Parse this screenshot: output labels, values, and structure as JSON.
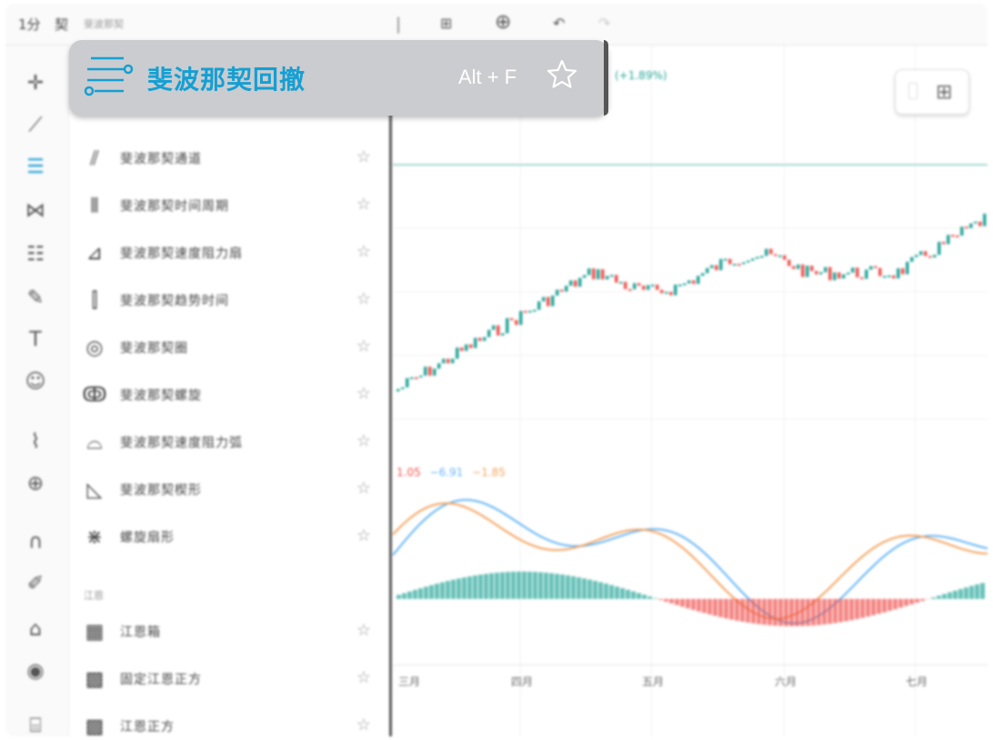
{
  "topbar": {
    "symbol_short": "1分",
    "chart_label": "契",
    "breadcrumb": "斐波那契",
    "icons": [
      "cursor-icon",
      "layout-grid-icon",
      "add-circle-icon",
      "undo-icon",
      "redo-icon"
    ]
  },
  "left_tools": [
    "crosshair-icon",
    "trend-line-icon",
    "fibonacci-icon",
    "pattern-icon",
    "forecast-icon",
    "brush-icon",
    "text-icon",
    "emoji-icon",
    "ruler-icon",
    "zoom-icon",
    "magnet-icon",
    "lock-drawing-icon",
    "unlock-icon",
    "eye-icon",
    "trash-icon"
  ],
  "tooltip": {
    "title": "斐波那契回撤",
    "shortcut": "Alt + F"
  },
  "panel": {
    "items": [
      {
        "label": "斐波那契通道",
        "icon": "fib-channel-icon"
      },
      {
        "label": "斐波那契时间周期",
        "icon": "fib-time-zone-icon"
      },
      {
        "label": "斐波那契速度阻力扇",
        "icon": "fib-speed-fan-icon"
      },
      {
        "label": "斐波那契趋势时间",
        "icon": "fib-trend-time-icon"
      },
      {
        "label": "斐波那契圈",
        "icon": "fib-circles-icon"
      },
      {
        "label": "斐波那契螺旋",
        "icon": "fib-spiral-icon"
      },
      {
        "label": "斐波那契速度阻力弧",
        "icon": "fib-speed-arcs-icon"
      },
      {
        "label": "斐波那契楔形",
        "icon": "fib-wedge-icon"
      },
      {
        "label": "螺旋扇形",
        "icon": "pitchfan-icon"
      }
    ],
    "section_gann": "江恩",
    "gann_items": [
      {
        "label": "江恩箱",
        "icon": "gann-box-icon"
      },
      {
        "label": "固定江恩正方",
        "icon": "gann-square-fixed-icon"
      },
      {
        "label": "江恩正方",
        "icon": "gann-square-icon"
      }
    ]
  },
  "chart": {
    "price_change": "(+1.89%)",
    "indicator_values": [
      "1.05",
      "−6.91",
      "−1.85"
    ],
    "x_labels": [
      "三月",
      "四月",
      "五月",
      "六月",
      "七月"
    ],
    "colors": {
      "up": "#26a69a",
      "down": "#ef5350",
      "macd_line": "#64b5f6",
      "signal_line": "#f5a25d",
      "accent": "#159fd3"
    }
  }
}
